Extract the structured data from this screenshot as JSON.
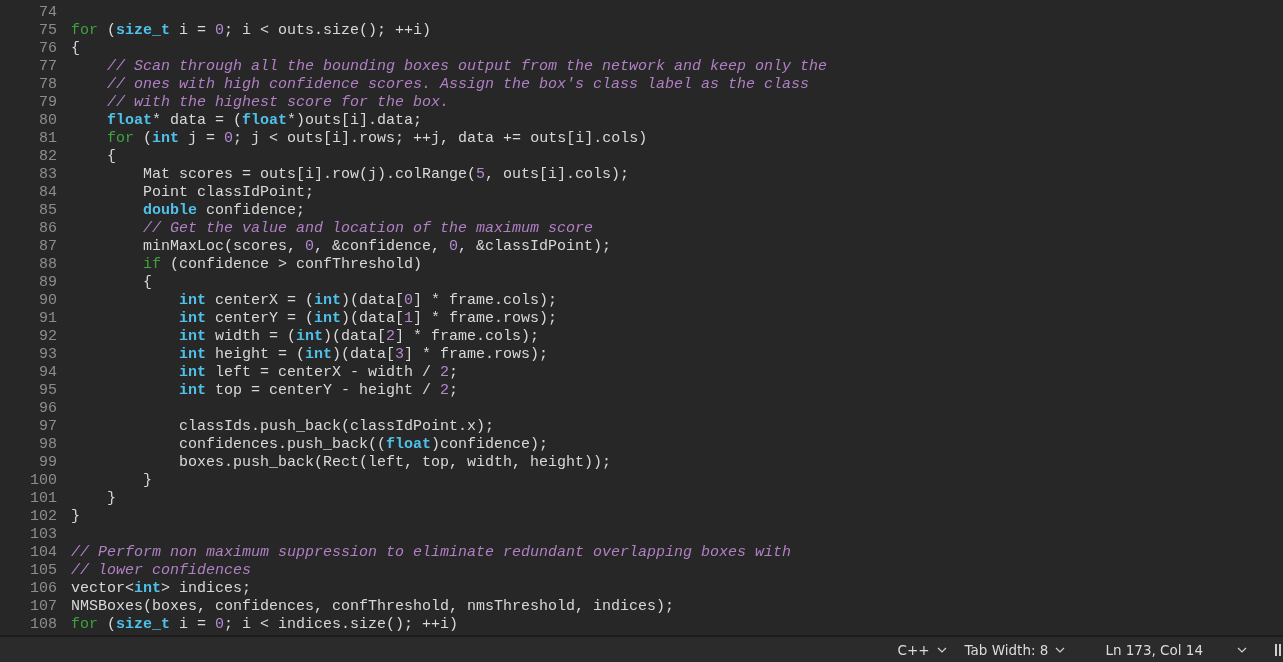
{
  "editor": {
    "lines": [
      {
        "number": "74"
      },
      {
        "number": "75",
        "tokens": [
          {
            "kind": "keyword",
            "text": "for"
          },
          {
            "kind": "plain",
            "text": " ("
          },
          {
            "kind": "type",
            "text": "size_t"
          },
          {
            "kind": "plain",
            "text": " i = "
          },
          {
            "kind": "number",
            "text": "0"
          },
          {
            "kind": "plain",
            "text": "; i < outs.size(); ++i)"
          }
        ]
      },
      {
        "number": "76",
        "tokens": [
          {
            "kind": "plain",
            "text": "{"
          }
        ],
        "children": [
          {
            "number": "77",
            "tokens": [
              {
                "kind": "comment",
                "text": "// Scan through all the bounding boxes output from the network and keep only the"
              }
            ]
          },
          {
            "number": "78",
            "tokens": [
              {
                "kind": "comment",
                "text": "// ones with high confidence scores. Assign the box's class label as the class"
              }
            ]
          },
          {
            "number": "79",
            "tokens": [
              {
                "kind": "comment",
                "text": "// with the highest score for the box."
              }
            ]
          },
          {
            "number": "80",
            "tokens": [
              {
                "kind": "type",
                "text": "float"
              },
              {
                "kind": "plain",
                "text": "* data = ("
              },
              {
                "kind": "type",
                "text": "float"
              },
              {
                "kind": "plain",
                "text": "*)outs[i].data;"
              }
            ]
          },
          {
            "number": "81",
            "tokens": [
              {
                "kind": "keyword",
                "text": "for"
              },
              {
                "kind": "plain",
                "text": " ("
              },
              {
                "kind": "type",
                "text": "int"
              },
              {
                "kind": "plain",
                "text": " j = "
              },
              {
                "kind": "number",
                "text": "0"
              },
              {
                "kind": "plain",
                "text": "; j < outs[i].rows; ++j, data += outs[i].cols)"
              }
            ]
          },
          {
            "number": "82",
            "tokens": [
              {
                "kind": "plain",
                "text": "{"
              }
            ],
            "children": [
              {
                "number": "83",
                "tokens": [
                  {
                    "kind": "plain",
                    "text": "Mat scores = outs[i].row(j).colRange("
                  },
                  {
                    "kind": "number",
                    "text": "5"
                  },
                  {
                    "kind": "plain",
                    "text": ", outs[i].cols);"
                  }
                ]
              },
              {
                "number": "84",
                "tokens": [
                  {
                    "kind": "plain",
                    "text": "Point classIdPoint;"
                  }
                ]
              },
              {
                "number": "85",
                "tokens": [
                  {
                    "kind": "type",
                    "text": "double"
                  },
                  {
                    "kind": "plain",
                    "text": " confidence;"
                  }
                ]
              },
              {
                "number": "86",
                "tokens": [
                  {
                    "kind": "comment",
                    "text": "// Get the value and location of the maximum score"
                  }
                ]
              },
              {
                "number": "87",
                "tokens": [
                  {
                    "kind": "plain",
                    "text": "minMaxLoc(scores, "
                  },
                  {
                    "kind": "number",
                    "text": "0"
                  },
                  {
                    "kind": "plain",
                    "text": ", &confidence, "
                  },
                  {
                    "kind": "number",
                    "text": "0"
                  },
                  {
                    "kind": "plain",
                    "text": ", &classIdPoint);"
                  }
                ]
              },
              {
                "number": "88",
                "tokens": [
                  {
                    "kind": "keyword",
                    "text": "if"
                  },
                  {
                    "kind": "plain",
                    "text": " (confidence > confThreshold)"
                  }
                ]
              },
              {
                "number": "89",
                "tokens": [
                  {
                    "kind": "plain",
                    "text": "{"
                  }
                ],
                "children": [
                  {
                    "number": "90",
                    "tokens": [
                      {
                        "kind": "type",
                        "text": "int"
                      },
                      {
                        "kind": "plain",
                        "text": " centerX = ("
                      },
                      {
                        "kind": "type",
                        "text": "int"
                      },
                      {
                        "kind": "plain",
                        "text": ")(data["
                      },
                      {
                        "kind": "number",
                        "text": "0"
                      },
                      {
                        "kind": "plain",
                        "text": "] * frame.cols);"
                      }
                    ]
                  },
                  {
                    "number": "91",
                    "tokens": [
                      {
                        "kind": "type",
                        "text": "int"
                      },
                      {
                        "kind": "plain",
                        "text": " centerY = ("
                      },
                      {
                        "kind": "type",
                        "text": "int"
                      },
                      {
                        "kind": "plain",
                        "text": ")(data["
                      },
                      {
                        "kind": "number",
                        "text": "1"
                      },
                      {
                        "kind": "plain",
                        "text": "] * frame.rows);"
                      }
                    ]
                  },
                  {
                    "number": "92",
                    "tokens": [
                      {
                        "kind": "type",
                        "text": "int"
                      },
                      {
                        "kind": "plain",
                        "text": " width = ("
                      },
                      {
                        "kind": "type",
                        "text": "int"
                      },
                      {
                        "kind": "plain",
                        "text": ")(data["
                      },
                      {
                        "kind": "number",
                        "text": "2"
                      },
                      {
                        "kind": "plain",
                        "text": "] * frame.cols);"
                      }
                    ]
                  },
                  {
                    "number": "93",
                    "tokens": [
                      {
                        "kind": "type",
                        "text": "int"
                      },
                      {
                        "kind": "plain",
                        "text": " height = ("
                      },
                      {
                        "kind": "type",
                        "text": "int"
                      },
                      {
                        "kind": "plain",
                        "text": ")(data["
                      },
                      {
                        "kind": "number",
                        "text": "3"
                      },
                      {
                        "kind": "plain",
                        "text": "] * frame.rows);"
                      }
                    ]
                  },
                  {
                    "number": "94",
                    "tokens": [
                      {
                        "kind": "type",
                        "text": "int"
                      },
                      {
                        "kind": "plain",
                        "text": " left = centerX - width / "
                      },
                      {
                        "kind": "number",
                        "text": "2"
                      },
                      {
                        "kind": "plain",
                        "text": ";"
                      }
                    ]
                  },
                  {
                    "number": "95",
                    "tokens": [
                      {
                        "kind": "type",
                        "text": "int"
                      },
                      {
                        "kind": "plain",
                        "text": " top = centerY - height / "
                      },
                      {
                        "kind": "number",
                        "text": "2"
                      },
                      {
                        "kind": "plain",
                        "text": ";"
                      }
                    ]
                  },
                  {
                    "number": "96"
                  },
                  {
                    "number": "97",
                    "tokens": [
                      {
                        "kind": "plain",
                        "text": "classIds.push_back(classIdPoint.x);"
                      }
                    ]
                  },
                  {
                    "number": "98",
                    "tokens": [
                      {
                        "kind": "plain",
                        "text": "confidences.push_back(("
                      },
                      {
                        "kind": "type",
                        "text": "float"
                      },
                      {
                        "kind": "plain",
                        "text": ")confidence);"
                      }
                    ]
                  },
                  {
                    "number": "99",
                    "tokens": [
                      {
                        "kind": "plain",
                        "text": "boxes.push_back(Rect(left, top, width, height));"
                      }
                    ]
                  }
                ]
              },
              {
                "number": "100",
                "tokens": [
                  {
                    "kind": "plain",
                    "text": "}"
                  }
                ]
              }
            ]
          },
          {
            "number": "101",
            "tokens": [
              {
                "kind": "plain",
                "text": "}"
              }
            ]
          }
        ]
      },
      {
        "number": "102",
        "tokens": [
          {
            "kind": "plain",
            "text": "}"
          }
        ]
      },
      {
        "number": "103"
      },
      {
        "number": "104",
        "tokens": [
          {
            "kind": "comment",
            "text": "// Perform non maximum suppression to eliminate redundant overlapping boxes with"
          }
        ]
      },
      {
        "number": "105",
        "tokens": [
          {
            "kind": "comment",
            "text": "// lower confidences"
          }
        ]
      },
      {
        "number": "106",
        "tokens": [
          {
            "kind": "plain",
            "text": "vector<"
          },
          {
            "kind": "type",
            "text": "int"
          },
          {
            "kind": "plain",
            "text": "> indices;"
          }
        ]
      },
      {
        "number": "107",
        "tokens": [
          {
            "kind": "plain",
            "text": "NMSBoxes(boxes, confidences, confThreshold, nmsThreshold, indices);"
          }
        ]
      },
      {
        "number": "108",
        "tokens": [
          {
            "kind": "keyword",
            "text": "for"
          },
          {
            "kind": "plain",
            "text": " ("
          },
          {
            "kind": "type",
            "text": "size_t"
          },
          {
            "kind": "plain",
            "text": " i = "
          },
          {
            "kind": "number",
            "text": "0"
          },
          {
            "kind": "plain",
            "text": "; i < indices.size(); ++i)"
          }
        ]
      }
    ]
  },
  "status_bar": {
    "language": "C++",
    "tab_width": "Tab Width: 8",
    "position": "Ln 173, Col 14"
  }
}
